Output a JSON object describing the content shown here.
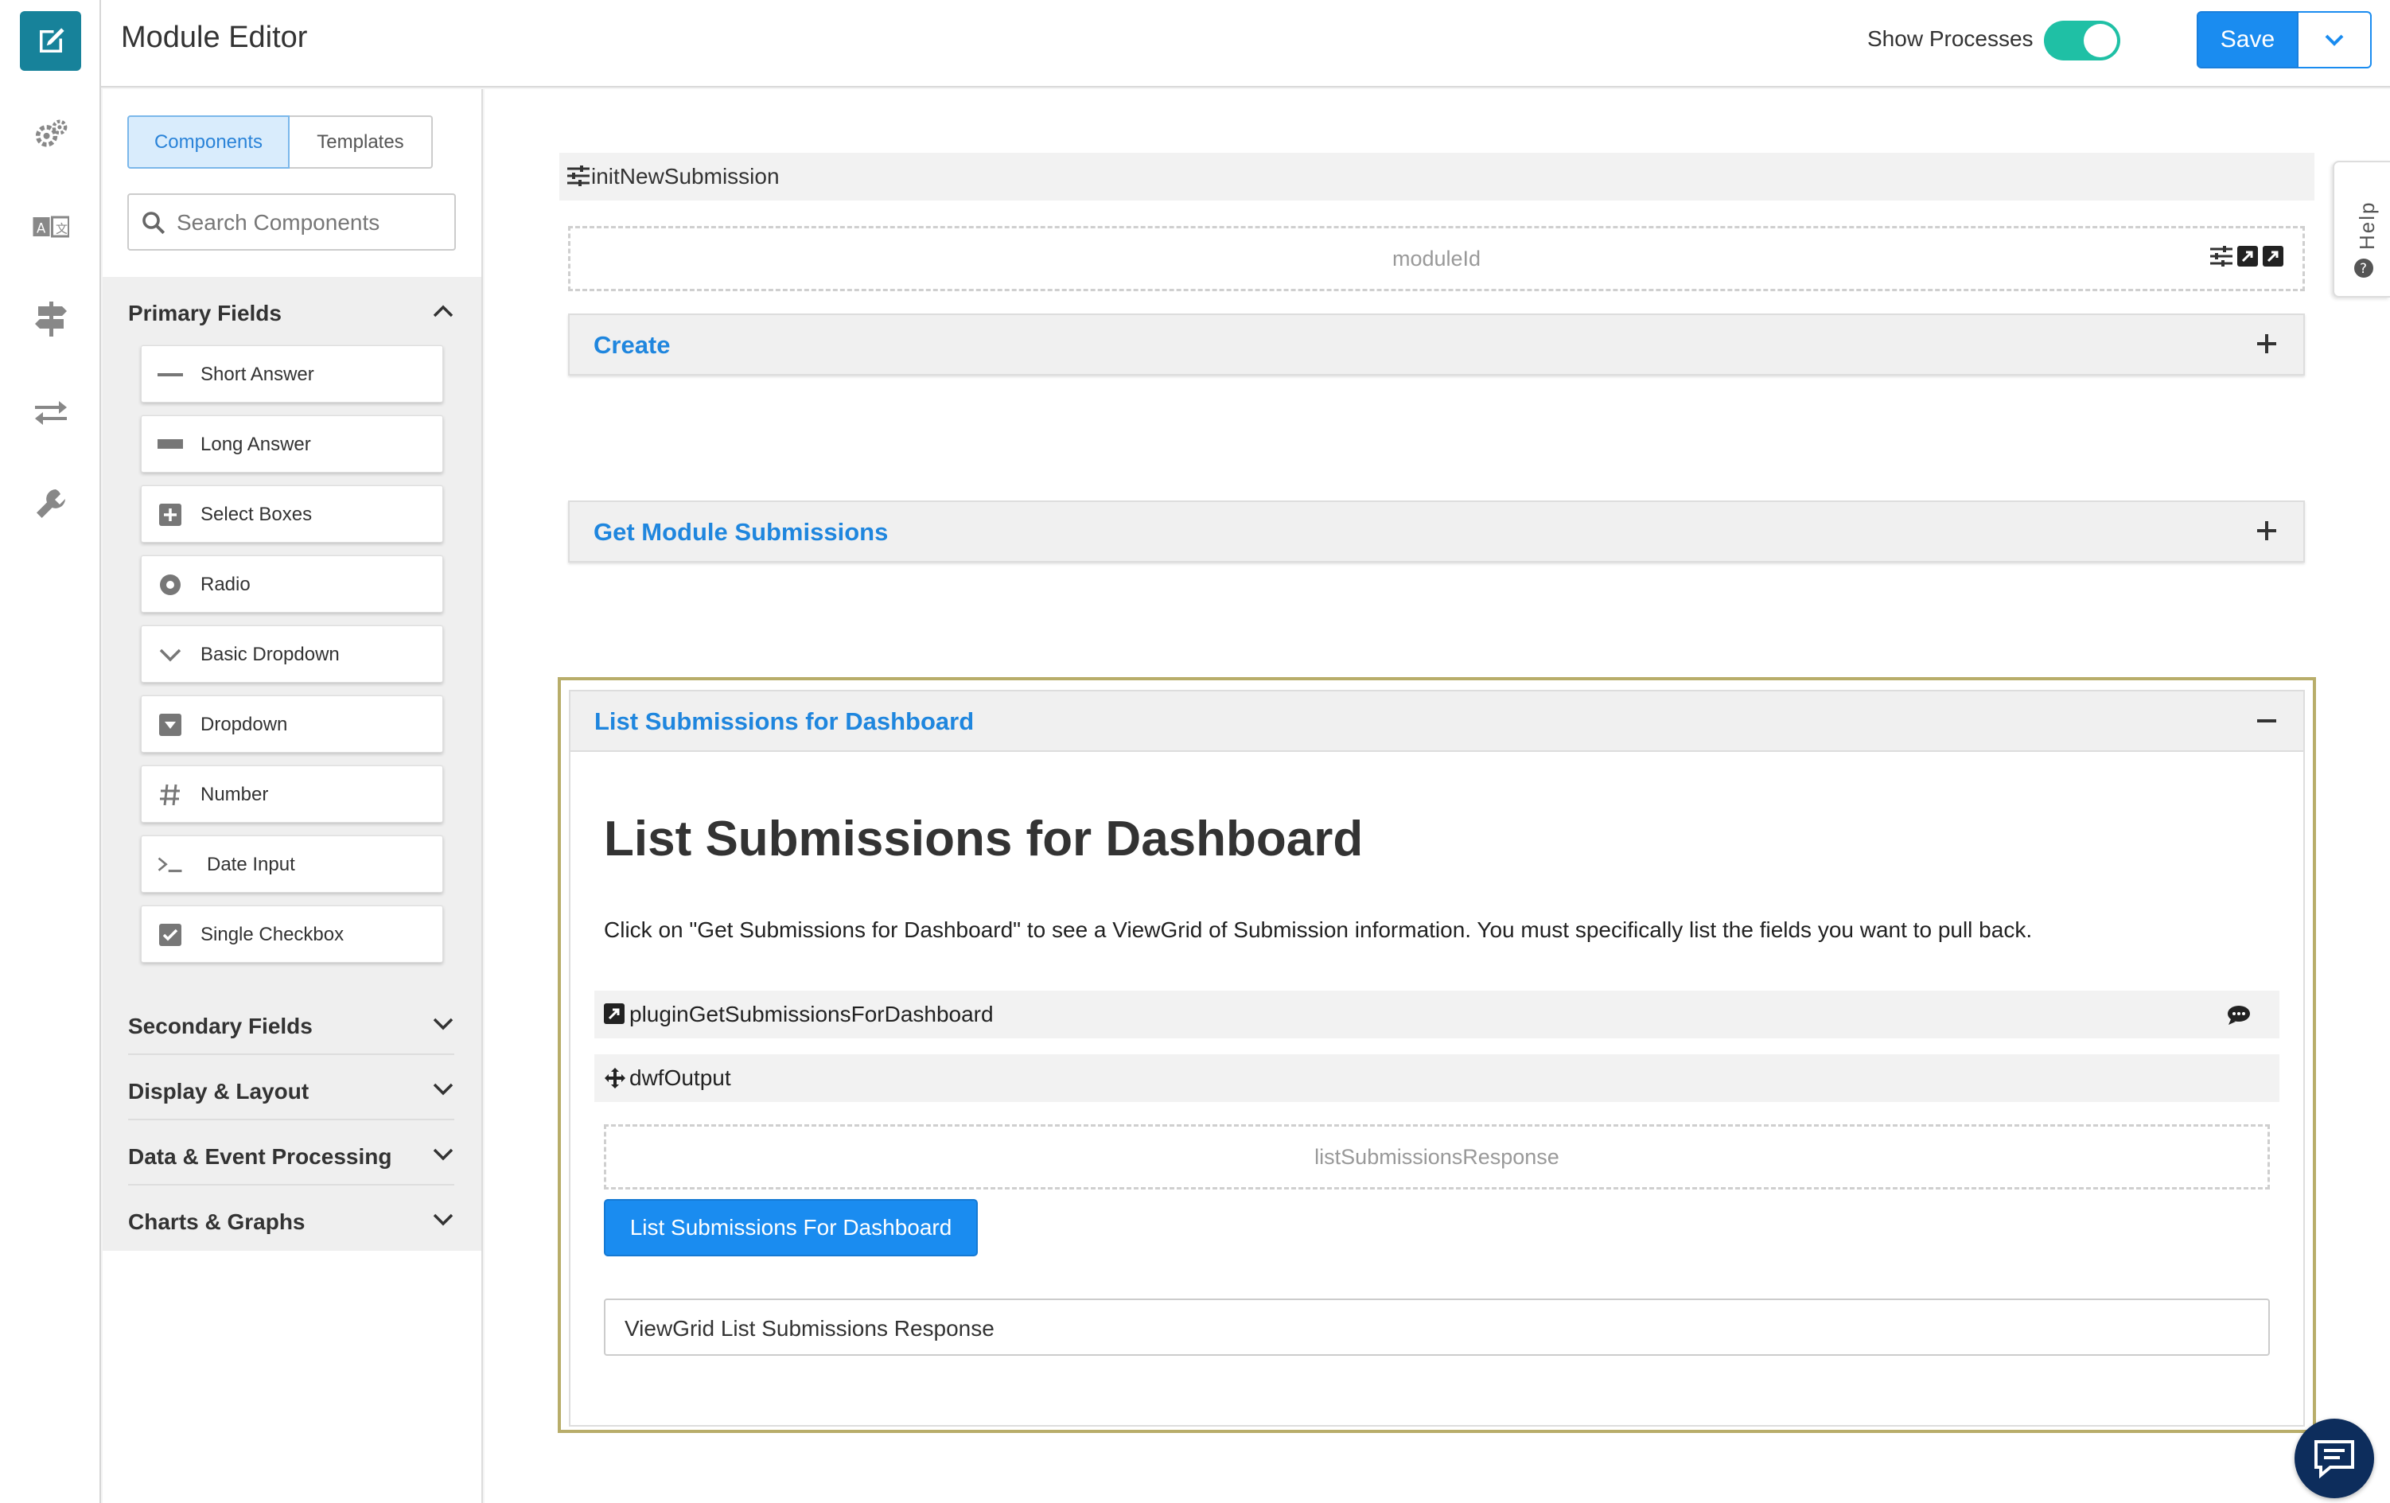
{
  "app": {
    "title": "Module Editor"
  },
  "header": {
    "show_processes_label": "Show Processes",
    "show_processes_on": true,
    "save_label": "Save"
  },
  "rail": {
    "icons": [
      "edit-icon",
      "gears-icon",
      "translate-icon",
      "signpost-icon",
      "exchange-icon",
      "wrench-icon"
    ]
  },
  "sidebar": {
    "tabs": [
      "Components",
      "Templates"
    ],
    "active_tab": "Components",
    "search_placeholder": "Search Components",
    "categories": {
      "primary": "Primary Fields",
      "secondary": "Secondary Fields",
      "display": "Display & Layout",
      "data": "Data & Event Processing",
      "charts": "Charts & Graphs"
    },
    "primary_items": [
      "Short Answer",
      "Long Answer",
      "Select Boxes",
      "Radio",
      "Basic Dropdown",
      "Dropdown",
      "Number",
      "Date Input",
      "Single Checkbox"
    ]
  },
  "canvas": {
    "process_name": "initNewSubmission",
    "module_id_field": "moduleId",
    "panels": {
      "create": "Create",
      "get_submissions": "Get Module Submissions",
      "list_dashboard": "List Submissions for Dashboard"
    },
    "dashboard": {
      "heading": "List Submissions for Dashboard",
      "description": "Click on \"Get Submissions for Dashboard\" to see a ViewGrid of Submission information. You must specifically list the fields you want to pull back.",
      "plugin_name": "pluginGetSubmissionsForDashboard",
      "output_name": "dwfOutput",
      "response_field": "listSubmissionsResponse",
      "button_label": "List Submissions For Dashboard",
      "viewgrid_label": "ViewGrid List Submissions Response"
    }
  },
  "help": {
    "label": "Help"
  },
  "colors": {
    "brand_teal": "#17829a",
    "primary_blue": "#1a8cf0",
    "toggle_on": "#1fc0a5",
    "selected_frame": "#b8ad6a",
    "chat_navy": "#0d2d5c"
  }
}
